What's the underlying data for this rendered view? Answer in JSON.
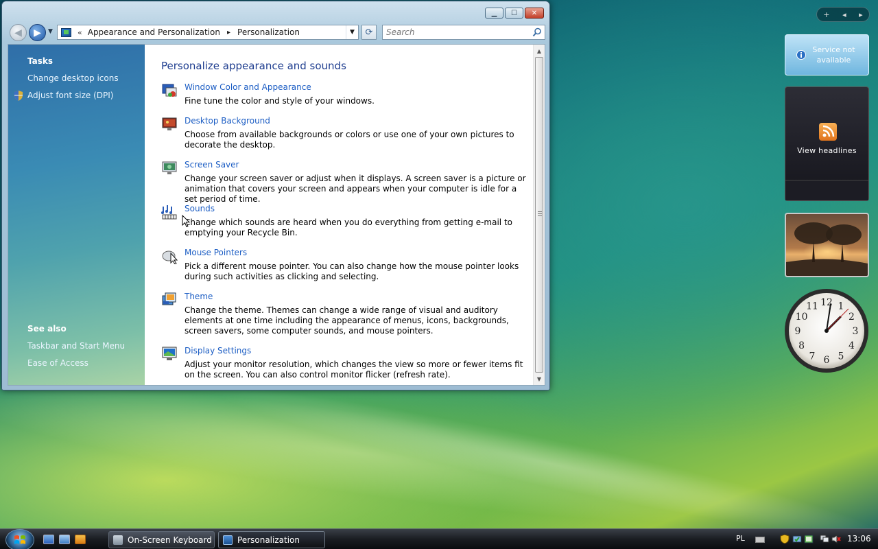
{
  "window": {
    "title_buttons": {
      "minimize": "minimize-icon",
      "maximize": "maximize-icon",
      "close": "close-icon"
    }
  },
  "address_bar": {
    "overflow": "«",
    "crumbs": [
      "Appearance and Personalization",
      "Personalization"
    ],
    "separator": "▸"
  },
  "search": {
    "placeholder": "Search"
  },
  "sidebar": {
    "tasks_heading": "Tasks",
    "tasks": [
      "Change desktop icons",
      "Adjust font size (DPI)"
    ],
    "see_also_heading": "See also",
    "see_also": [
      "Taskbar and Start Menu",
      "Ease of Access"
    ]
  },
  "main": {
    "title": "Personalize appearance and sounds",
    "items": [
      {
        "label": "Window Color and Appearance",
        "desc": "Fine tune the color and style of your windows.",
        "icon": "window-color-icon"
      },
      {
        "label": "Desktop Background",
        "desc": "Choose from available backgrounds or colors or use one of your own pictures to decorate the desktop.",
        "icon": "desktop-background-icon"
      },
      {
        "label": "Screen Saver",
        "desc": "Change your screen saver or adjust when it displays. A screen saver is a picture or animation that covers your screen and appears when your computer is idle for a set period of time.",
        "icon": "screen-saver-icon"
      },
      {
        "label": "Sounds",
        "desc": "Change which sounds are heard when you do everything from getting e-mail to emptying your Recycle Bin.",
        "icon": "sounds-icon"
      },
      {
        "label": "Mouse Pointers",
        "desc": "Pick a different mouse pointer. You can also change how the mouse pointer looks during such activities as clicking and selecting.",
        "icon": "mouse-pointer-icon"
      },
      {
        "label": "Theme",
        "desc": "Change the theme. Themes can change a wide range of visual and auditory elements at one time including the appearance of menus, icons, backgrounds, screen savers, some computer sounds, and mouse pointers.",
        "icon": "theme-icon"
      },
      {
        "label": "Display Settings",
        "desc": "Adjust your monitor resolution, which changes the view so more or fewer items fit on the screen. You can also control monitor flicker (refresh rate).",
        "icon": "display-settings-icon"
      }
    ]
  },
  "gadgets": {
    "controls": {
      "add": "+",
      "prev": "◂",
      "next": "▸"
    },
    "weather_text": "Service not available",
    "feed_text": "View headlines",
    "clock_numbers": [
      "12",
      "1",
      "2",
      "3",
      "4",
      "5",
      "6",
      "7",
      "8",
      "9",
      "10",
      "11"
    ]
  },
  "taskbar": {
    "tasks": [
      "On-Screen Keyboard",
      "Personalization"
    ],
    "language": "PL",
    "time": "13:06"
  },
  "colors": {
    "link": "#1d5ec4",
    "title": "#1e3d8f",
    "sidebar_top": "#2f6ea8"
  }
}
